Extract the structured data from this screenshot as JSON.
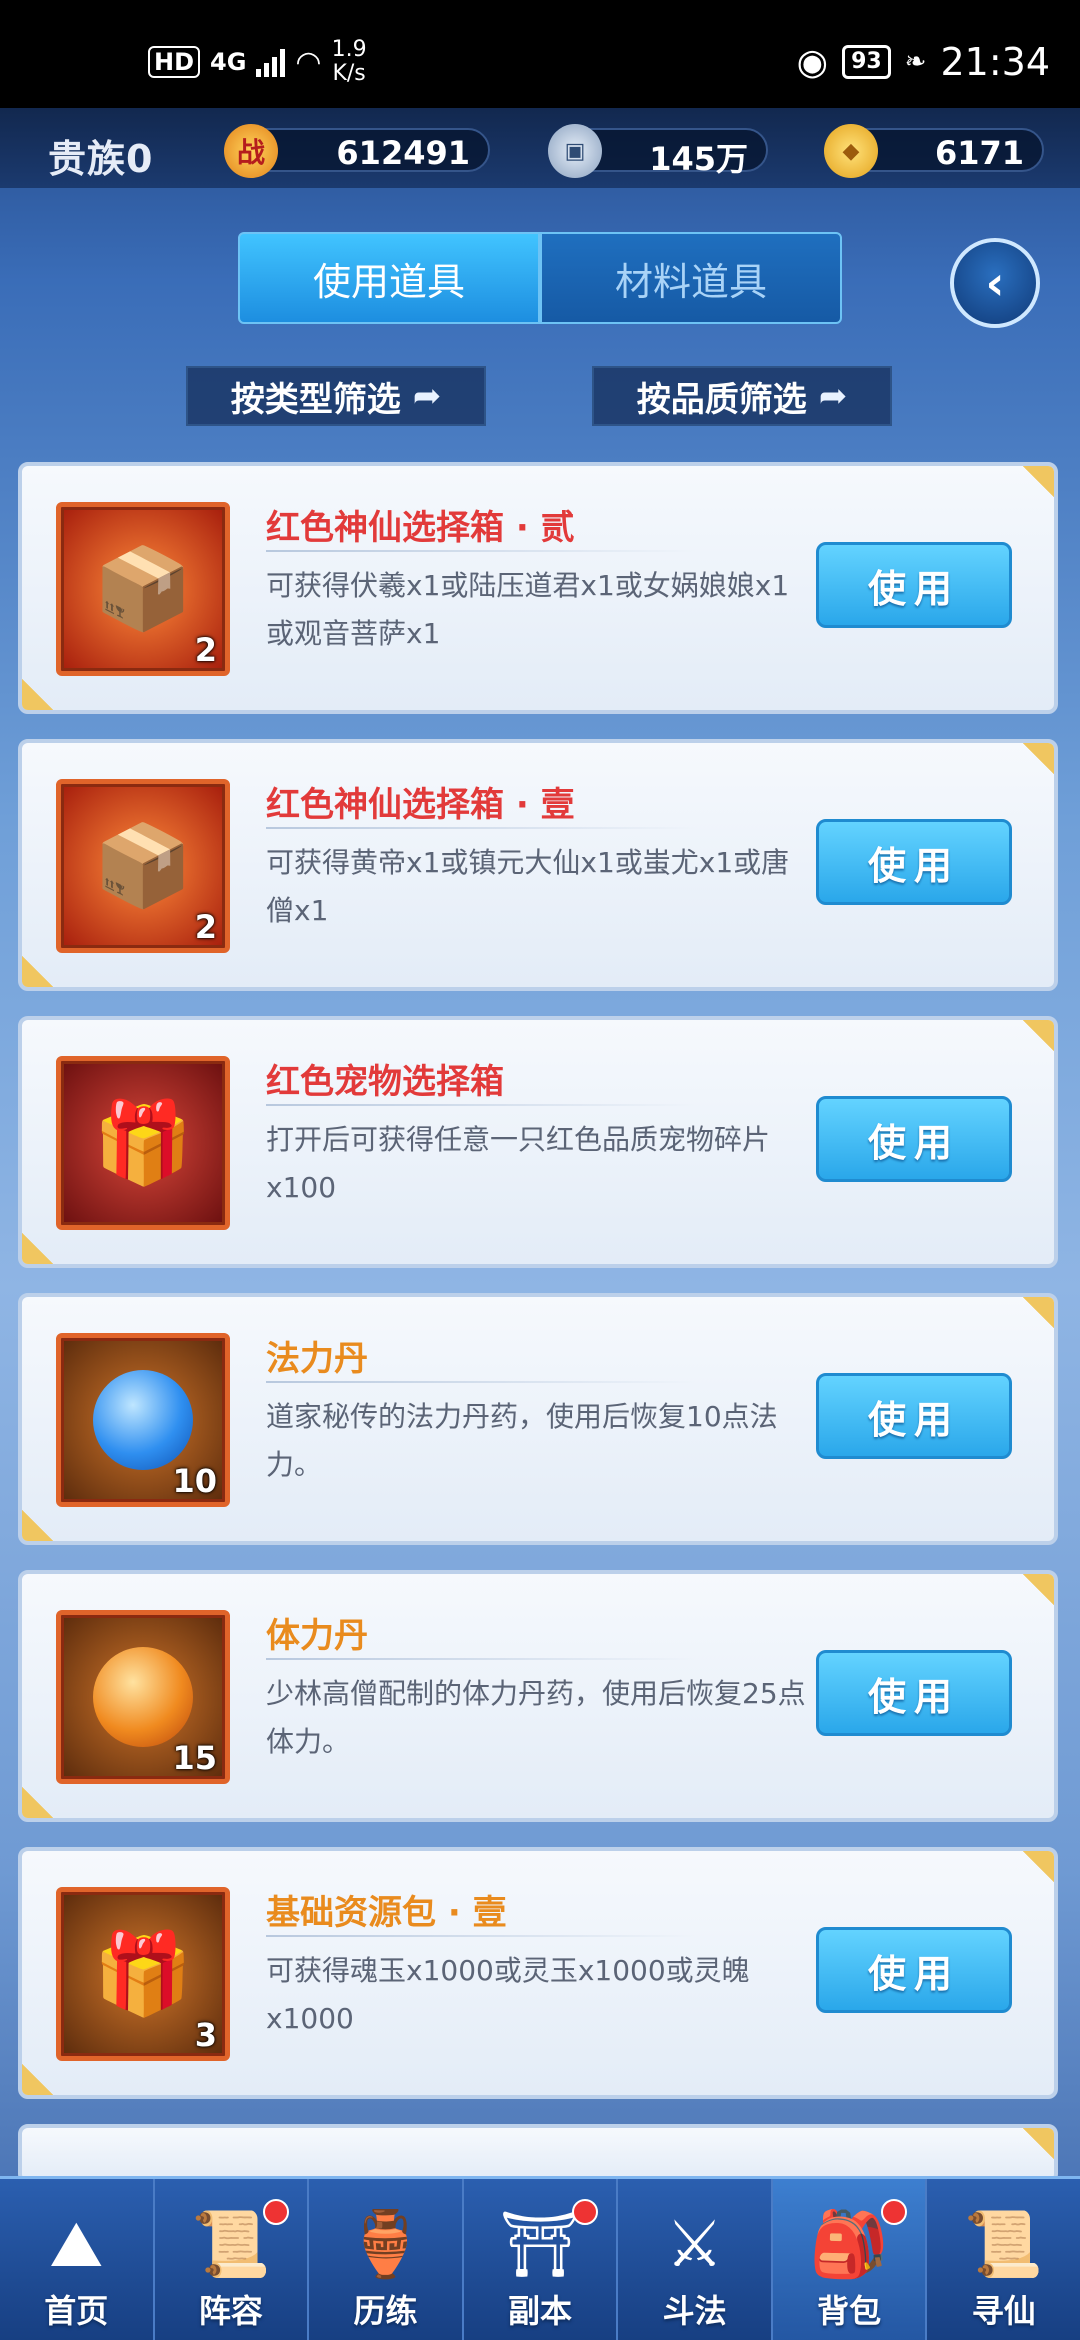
{
  "status_bar": {
    "hd": "HD",
    "network": "4G",
    "speed_value": "1.9",
    "speed_unit": "K/s",
    "battery": "93",
    "time": "21:34"
  },
  "resources": {
    "noble": "贵族0",
    "combat": {
      "icon": "战",
      "value": "612491"
    },
    "coin": {
      "value": "145万"
    },
    "gold": {
      "value": "6171"
    }
  },
  "tabs": [
    {
      "label": "使用道具",
      "active": true
    },
    {
      "label": "材料道具",
      "active": false
    }
  ],
  "filters": {
    "by_type": "按类型筛选",
    "by_quality": "按品质筛选"
  },
  "items": [
    {
      "name": "红色神仙选择箱 · 贰",
      "name_color": "red",
      "desc": "可获得伏羲x1或陆压道君x1或女娲娘娘x1或观音菩萨x1",
      "count": "2",
      "icon": "box-icon",
      "button": "使用"
    },
    {
      "name": "红色神仙选择箱 · 壹",
      "name_color": "red",
      "desc": "可获得黄帝x1或镇元大仙x1或蚩尤x1或唐僧x1",
      "count": "2",
      "icon": "box-icon",
      "button": "使用"
    },
    {
      "name": "红色宠物选择箱",
      "name_color": "red",
      "desc": "打开后可获得任意一只红色品质宠物碎片x100",
      "count": "",
      "icon": "chest-icon",
      "button": "使用"
    },
    {
      "name": "法力丹",
      "name_color": "orange",
      "desc": "道家秘传的法力丹药，使用后恢复10点法力。",
      "count": "10",
      "icon": "blue-pill-icon",
      "button": "使用"
    },
    {
      "name": "体力丹",
      "name_color": "orange",
      "desc": "少林高僧配制的体力丹药，使用后恢复25点体力。",
      "count": "15",
      "icon": "orange-pill-icon",
      "button": "使用"
    },
    {
      "name": "基础资源包 · 壹",
      "name_color": "orange",
      "desc": "可获得魂玉x1000或灵玉x1000或灵魄x1000",
      "count": "3",
      "icon": "gift-icon",
      "button": "使用"
    }
  ],
  "nav": [
    {
      "label": "首页",
      "badge": false
    },
    {
      "label": "阵容",
      "badge": true
    },
    {
      "label": "历练",
      "badge": false
    },
    {
      "label": "副本",
      "badge": true
    },
    {
      "label": "斗法",
      "badge": false
    },
    {
      "label": "背包",
      "badge": true,
      "active": true
    },
    {
      "label": "寻仙",
      "badge": false
    }
  ]
}
